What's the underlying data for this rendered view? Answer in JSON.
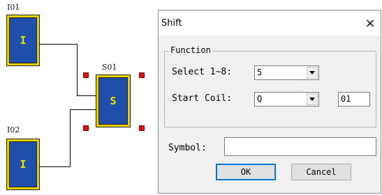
{
  "diagram": {
    "blocks": [
      {
        "id": "I01",
        "glyph": "I"
      },
      {
        "id": "S01",
        "glyph": "S"
      },
      {
        "id": "I02",
        "glyph": "I"
      }
    ]
  },
  "dialog": {
    "title": "Shift",
    "close_glyph": "×",
    "group_label": "Function",
    "select_label": "Select 1~8:",
    "select_value": "5",
    "start_coil_label": "Start Coil:",
    "start_coil_value": "Q",
    "coil_number": "01",
    "symbol_label": "Symbol:",
    "symbol_value": "",
    "ok_label": "OK",
    "cancel_label": "Cancel"
  },
  "colors": {
    "block_fill": "#1f4fa8",
    "block_border": "#e6d000",
    "selection_handle": "#e01010"
  }
}
